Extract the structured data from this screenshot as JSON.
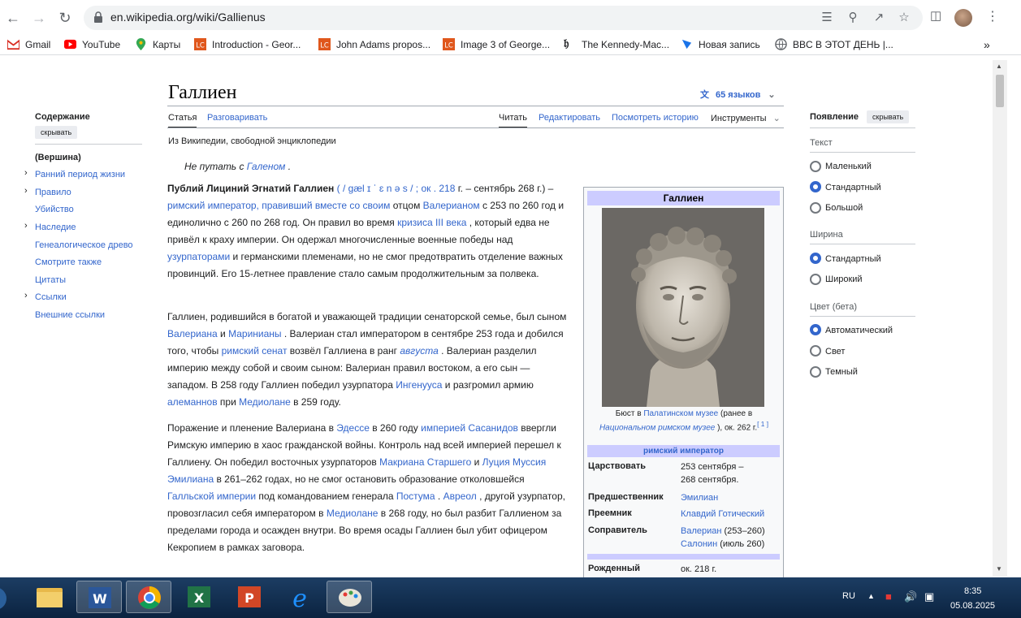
{
  "browser": {
    "url": "en.wikipedia.org/wiki/Gallienus",
    "bookmarks": [
      "Gmail",
      "YouTube",
      "Карты",
      "Introduction - Geor...",
      "John Adams propos...",
      "Image 3 of George...",
      "The Kennedy-Mac...",
      "Новая запись",
      "BBC В ЭТОТ ДЕНЬ |..."
    ],
    "more": "»"
  },
  "article": {
    "title": "Галлиен",
    "languages": "65 языков",
    "tabs": {
      "article": "Статья",
      "talk": "Разговаривать",
      "read": "Читать",
      "edit": "Редактировать",
      "history": "Посмотреть историю",
      "tools": "Инструменты"
    },
    "from": "Из Википедии, свободной энциклопедии",
    "hatnote_prefix": "Не путать с",
    "hatnote_link": "Галеном",
    "hatnote_suffix": ".",
    "paragraphs": [
      [
        {
          "t": "Публий Лициний Эгнатий Галлиен",
          "b": true
        },
        {
          "t": " "
        },
        {
          "t": "( / ",
          "a": true
        },
        {
          "t": " gæl ɪ ˈ ɛ n ə s / ; ок . 218",
          "a": true
        },
        {
          "t": " г. "
        },
        {
          "t": " – сентябрь 268 г.) – "
        },
        {
          "t": "римский император, правивший вместе со своим",
          "a": true
        },
        {
          "t": " отцом "
        },
        {
          "t": "Валерианом",
          "a": true
        },
        {
          "t": " с 253 по 260 год и единолично с 260 по 268 год. Он правил во время "
        },
        {
          "t": "кризиса III века",
          "a": true
        },
        {
          "t": " , который едва не привёл к краху империи. Он одержал многочисленные военные победы над "
        },
        {
          "t": "узурпаторами",
          "a": true
        },
        {
          "t": " и германскими племенами, но не смог предотвратить отделение важных провинций. Его 15-летнее правление стало самым продолжительным за полвека."
        }
      ],
      [
        {
          "t": "Галлиен, родившийся в богатой и уважающей традиции сенаторской семье, был сыном "
        },
        {
          "t": "Валериана",
          "a": true
        },
        {
          "t": " и "
        },
        {
          "t": "Маринианы",
          "a": true
        },
        {
          "t": " . Валериан стал императором в сентябре 253 года и добился того, чтобы "
        },
        {
          "t": "римский сенат",
          "a": true
        },
        {
          "t": " возвёл Галлиена в ранг "
        },
        {
          "t": "августа",
          "a": true,
          "i": true
        },
        {
          "t": " . Валериан разделил империю между собой и своим сыном: Валериан правил востоком, а его сын — западом. В 258 году Галлиен победил узурпатора "
        },
        {
          "t": "Ингенууса",
          "a": true
        },
        {
          "t": " и разгромил армию "
        },
        {
          "t": "алеманнов",
          "a": true
        },
        {
          "t": " при "
        },
        {
          "t": "Медиолане",
          "a": true
        },
        {
          "t": " в 259 году."
        }
      ],
      [
        {
          "t": "Поражение и пленение Валериана в "
        },
        {
          "t": "Эдессе",
          "a": true
        },
        {
          "t": " в 260 году "
        },
        {
          "t": "империей Сасанидов",
          "a": true
        },
        {
          "t": " ввергли Римскую империю в хаос гражданской войны. Контроль над всей империей перешел к Галлиену. Он победил восточных узурпаторов "
        },
        {
          "t": "Макриана Старшего",
          "a": true
        },
        {
          "t": " и "
        },
        {
          "t": "Луция Муссия Эмилиана",
          "a": true
        },
        {
          "t": " в 261–262 годах, но не смог остановить образование отколовшейся "
        },
        {
          "t": "Галльской империи",
          "a": true
        },
        {
          "t": " под командованием генерала "
        },
        {
          "t": "Постума",
          "a": true
        },
        {
          "t": " . "
        },
        {
          "t": "Авреол",
          "a": true
        },
        {
          "t": " , другой узурпатор, провозгласил себя императором в "
        },
        {
          "t": "Медиолане",
          "a": true
        },
        {
          "t": " в 268 году, но был разбит Галлиеном за пределами города и осажден внутри. Во время осады Галлиен был убит офицером Кекропием в рамках заговора."
        }
      ]
    ]
  },
  "toc": {
    "heading": "Содержание",
    "hide": "скрывать",
    "items": [
      "(Вершина)",
      "Ранний период жизни",
      "Правило",
      "Убийство",
      "Наследие",
      "Генеалогическое древо",
      "Смотрите также",
      "Цитаты",
      "Ссылки",
      "Внешние ссылки"
    ]
  },
  "infobox": {
    "title": "Галлиен",
    "caption_pre": "Бюст в ",
    "caption_link1": "Палатинском музее",
    "caption_mid": " (ранее в ",
    "caption_link2": "Национальном римском музее",
    "caption_post": " ), ок. 262 г.",
    "caption_ref": "[ 1 ]",
    "section": "римский император",
    "rows": [
      {
        "label": "Царствовать",
        "value": "253 сентября –\n268 сентября."
      },
      {
        "label": "Предшественник",
        "value": "Эмилиан"
      },
      {
        "label": "Преемник",
        "value": "Клавдий Готический"
      },
      {
        "label": "Соправитель",
        "value": "Валериан (253–260)\nСалонин (июль 260)"
      },
      {
        "label": "Рожденный",
        "value": "ок. 218 г."
      }
    ]
  },
  "appearance": {
    "heading": "Появление",
    "hide": "скрывать",
    "text_heading": "Текст",
    "text_options": [
      "Маленький",
      "Стандартный",
      "Большой"
    ],
    "width_heading": "Ширина",
    "width_options": [
      "Стандартный",
      "Широкий"
    ],
    "color_heading": "Цвет (бета)",
    "color_options": [
      "Автоматический",
      "Свет",
      "Темный"
    ]
  },
  "taskbar": {
    "lang": "RU",
    "time": "8:35",
    "date": "05.08.2025"
  }
}
